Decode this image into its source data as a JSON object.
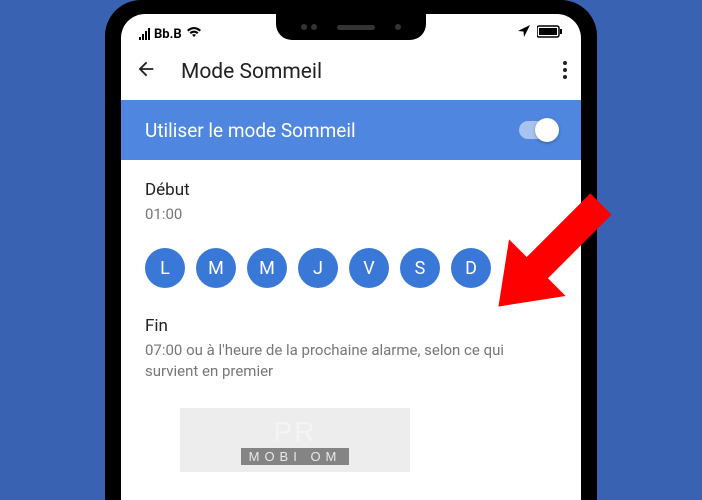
{
  "statusbar": {
    "carrier": "Bb.B"
  },
  "appbar": {
    "title": "Mode Sommeil"
  },
  "banner": {
    "label": "Utiliser le mode Sommeil"
  },
  "start": {
    "label": "Début",
    "time": "01:00"
  },
  "days": [
    "L",
    "M",
    "M",
    "J",
    "V",
    "S",
    "D"
  ],
  "end": {
    "label": "Fin",
    "value": "07:00 ou à l'heure de la prochaine alarme, selon ce qui survient en premier"
  },
  "watermark": {
    "line1": "PR",
    "line2": "MOBI   OM"
  }
}
